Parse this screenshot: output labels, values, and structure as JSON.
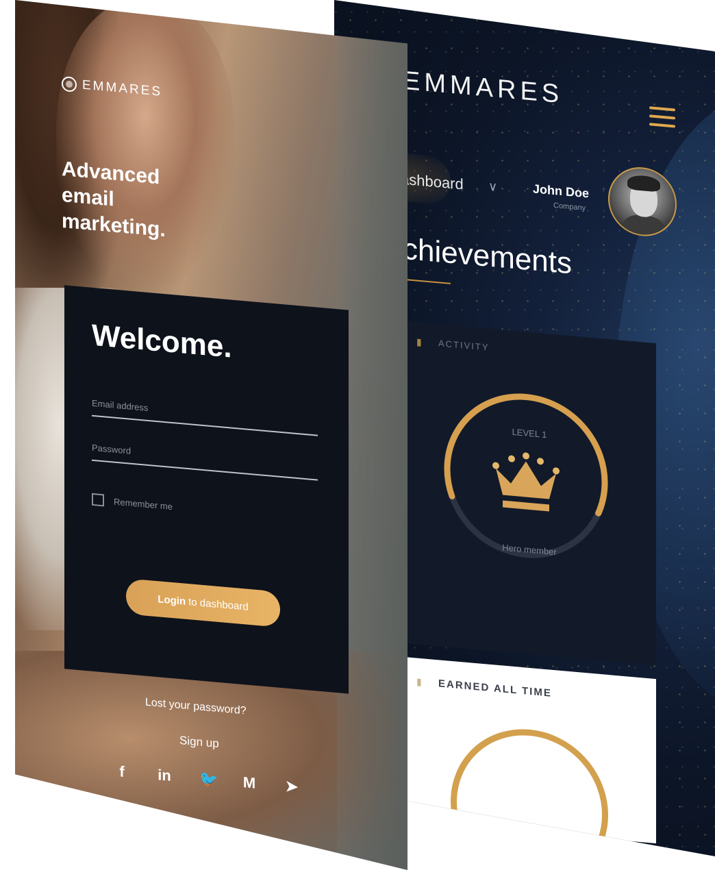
{
  "colors": {
    "gold": "#d8a157",
    "card_dark": "#0e121b",
    "dashboard_bg": "#0c1526"
  },
  "dashboard": {
    "brand": "EMMARES",
    "menu_icon": "hamburger-icon",
    "nav_label": "ashboard",
    "user": {
      "name": "John Doe",
      "company": "Company"
    },
    "heading": "chievements",
    "activity_card": {
      "tab_label": "ACTIVITY",
      "level": "LEVEL 1",
      "member": "Hero member",
      "progress_fraction": 0.62,
      "icon": "crown-icon"
    },
    "earned_card": {
      "tab_label": "EARNED ALL TIME"
    }
  },
  "login": {
    "brand": "EMMARES",
    "tagline": "Advanced email marketing.",
    "welcome": "Welcome.",
    "email_placeholder": "Email address",
    "password_placeholder": "Password",
    "remember_label": "Remember me",
    "button_bold": "Login",
    "button_rest": "to dashboard",
    "lost_password": "Lost your password?",
    "sign_up": "Sign up",
    "socials": [
      "f",
      "in",
      "🐦",
      "M",
      "➤"
    ]
  }
}
